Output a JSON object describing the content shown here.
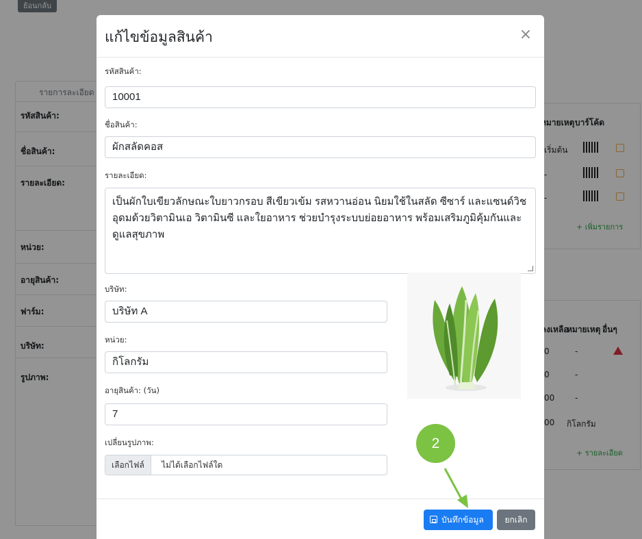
{
  "background": {
    "back_button": "ย้อนกลับ",
    "tab_label": "รายการละเอียด",
    "labels": [
      "รหัสสินค้า:",
      "ชื่อสินค้า:",
      "รายละเอียด:",
      "หน่วย:",
      "อายุสินค้า:",
      "ฟาร์ม:",
      "บริษัท:",
      "รูปภาพ:"
    ],
    "table1": {
      "headers": [
        "หมายเหตุ",
        "บาร์โค้ด"
      ],
      "rows": [
        [
          "เริ่มต้น"
        ],
        [
          "-"
        ],
        [
          "-"
        ]
      ],
      "add_link": "+ เพิ่มรายการ"
    },
    "table2": {
      "headers": [
        "คงเหลือ",
        "หมายเหตุ",
        "อื่นๆ"
      ],
      "rows": [
        [
          "0",
          "-"
        ],
        [
          "0",
          "-"
        ],
        [
          "00",
          "-"
        ],
        [
          "00",
          "กิโลกรัม"
        ]
      ],
      "add_link": "+ รายละเอียด"
    }
  },
  "modal": {
    "title": "แก้ไขข้อมูลสินค้า",
    "close_symbol": "×",
    "fields": {
      "code_label": "รหัสสินค้า:",
      "code_value": "10001",
      "name_label": "ชื่อสินค้า:",
      "name_value": "ผักสลัดคอส",
      "desc_label": "รายละเอียด:",
      "desc_value": "เป็นผักใบเขียวลักษณะใบยาวกรอบ สีเขียวเข้ม รสหวานอ่อน นิยมใช้ในสลัด ซีซาร์ และแซนด์วิช อุดมด้วยวิตามินเอ วิตามินซี และใยอาหาร ช่วยบำรุงระบบย่อยอาหาร พร้อมเสริมภูมิคุ้มกันและดูแลสุขภาพ",
      "company_label": "บริษัท:",
      "company_value": "บริษัท A",
      "unit_label": "หน่วย:",
      "unit_value": "กิโลกรัม",
      "shelf_label": "อายุสินค้า: (วัน)",
      "shelf_value": "7",
      "image_label": "เปลี่ยนรูปภาพ:",
      "file_button": "เลือกไฟล์",
      "file_status": "ไม่ได้เลือกไฟล์ใด"
    },
    "buttons": {
      "save": "บันทึกข้อมูล",
      "cancel": "ยกเลิก"
    }
  },
  "annotation": {
    "step_number": "2",
    "color": "#7cc243"
  },
  "colors": {
    "primary": "#1a7cf2",
    "secondary": "#6c757d",
    "danger": "#dc3545",
    "success": "#28a745"
  }
}
